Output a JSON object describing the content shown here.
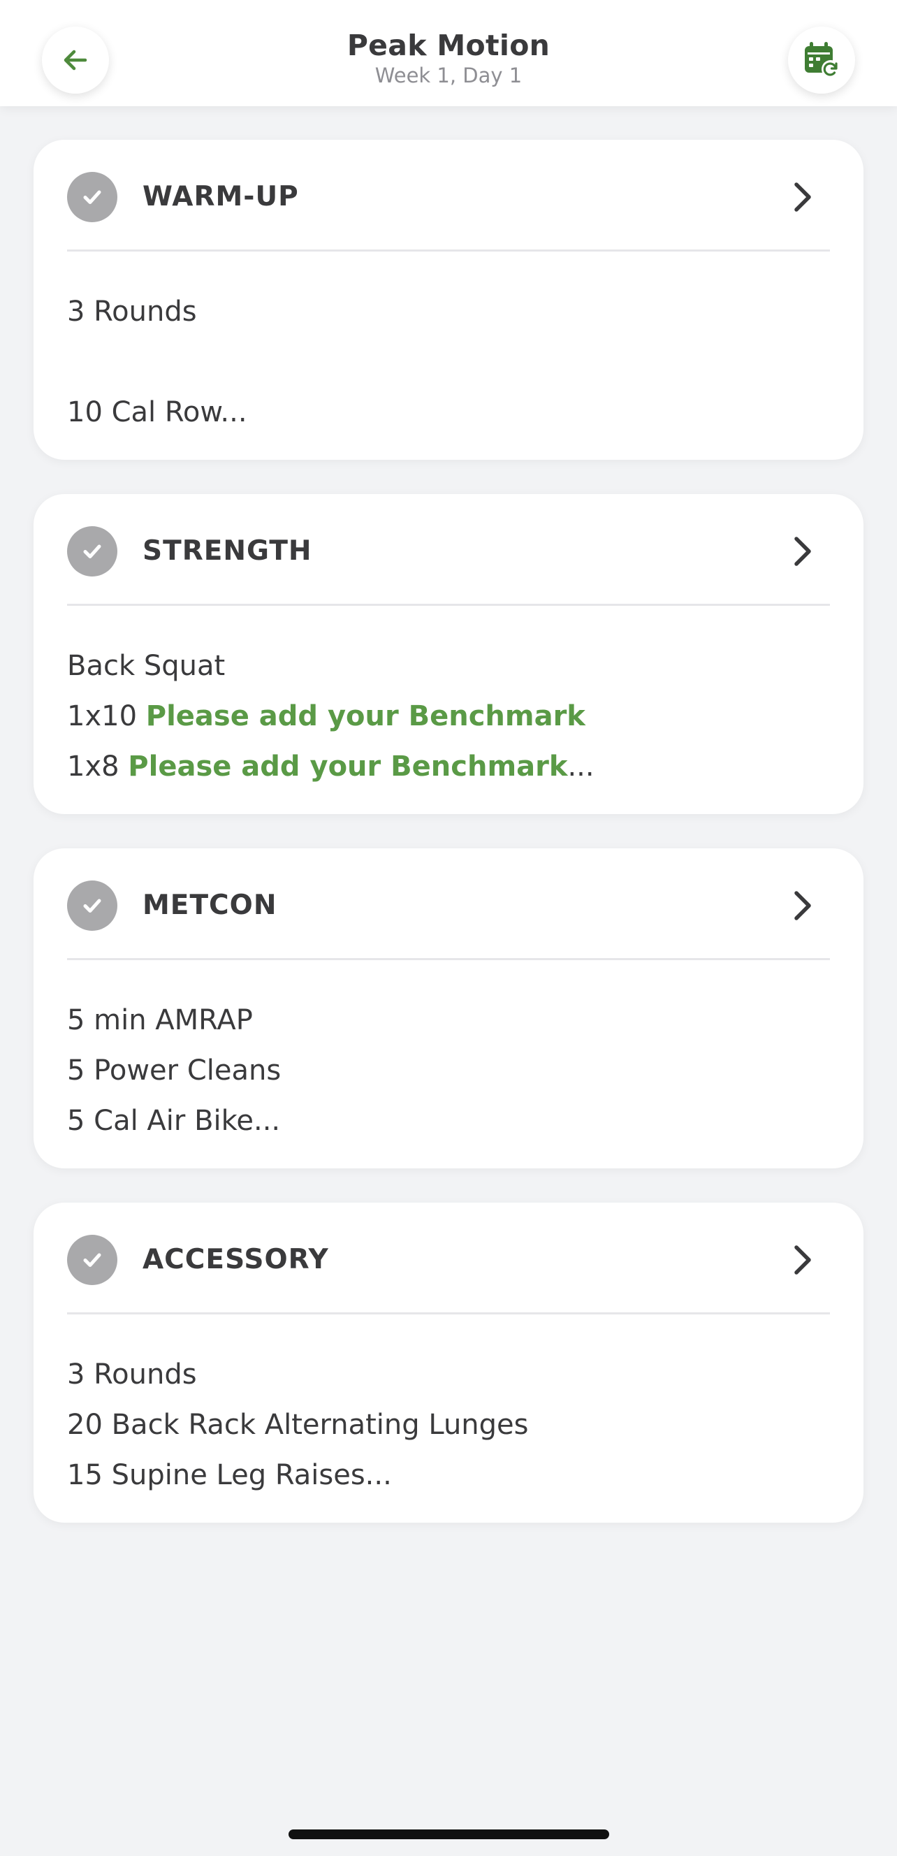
{
  "header": {
    "title": "Peak Motion",
    "subtitle": "Week 1, Day 1",
    "back_icon": "arrow-left-icon",
    "calendar_icon": "calendar-sync-icon"
  },
  "colors": {
    "accent": "#5a9a46",
    "check": "#a9a9ab",
    "background": "#f2f3f5"
  },
  "sections": [
    {
      "title": "WARM-UP",
      "lines": [
        "3 Rounds",
        "10 Cal Row..."
      ]
    },
    {
      "title": "STRENGTH",
      "lines": [
        "Back Squat"
      ],
      "benchmark_lines": [
        {
          "prefix": "1x10",
          "text": "Please add your Benchmark",
          "suffix": ""
        },
        {
          "prefix": "1x8",
          "text": "Please add your Benchmark",
          "suffix": "..."
        }
      ]
    },
    {
      "title": "METCON",
      "lines": [
        "5 min AMRAP",
        "5 Power Cleans",
        "5 Cal Air Bike..."
      ]
    },
    {
      "title": "ACCESSORY",
      "lines": [
        "3 Rounds",
        "20 Back Rack Alternating Lunges",
        "15 Supine Leg Raises..."
      ]
    }
  ]
}
